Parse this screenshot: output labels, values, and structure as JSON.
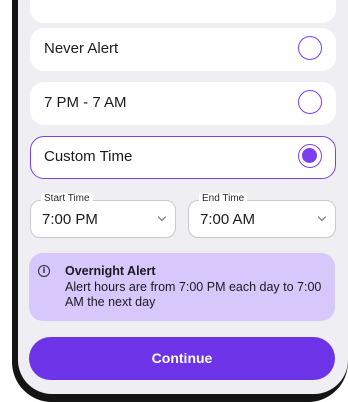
{
  "options": [
    {
      "label": "Never Alert",
      "selected": false
    },
    {
      "label": "7 PM - 7 AM",
      "selected": false
    },
    {
      "label": "Custom Time",
      "selected": true
    }
  ],
  "start_time": {
    "label": "Start Time",
    "value": "7:00 PM"
  },
  "end_time": {
    "label": "End Time",
    "value": "7:00 AM"
  },
  "alert": {
    "icon": "info-icon",
    "title": "Overnight Alert",
    "body": "Alert hours are from 7:00 PM each day to 7:00 AM the next day"
  },
  "continue_label": "Continue",
  "colors": {
    "accent": "#7b3ff0",
    "alert_bg": "#d7c7fb",
    "button": "#6d33e6"
  }
}
